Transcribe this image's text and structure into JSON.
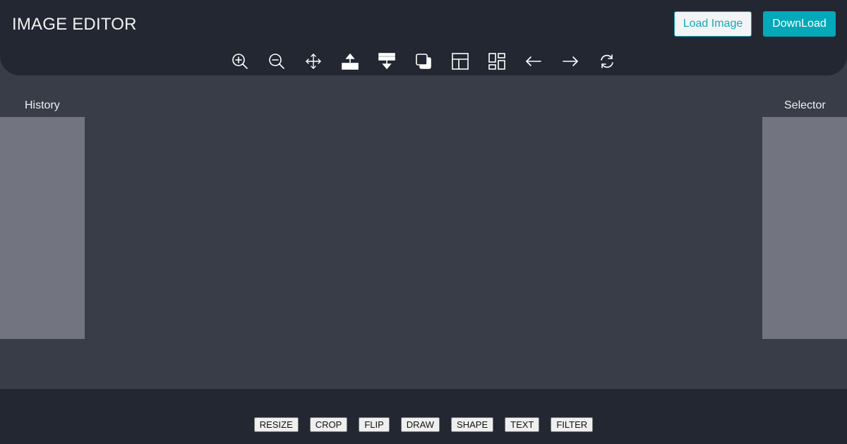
{
  "header": {
    "title": "IMAGE EDITOR",
    "load_label": "Load Image",
    "download_label": "DownLoad"
  },
  "toolbar": {
    "tools": [
      {
        "name": "zoom-in-icon"
      },
      {
        "name": "zoom-out-icon"
      },
      {
        "name": "move-icon"
      },
      {
        "name": "bring-forward-icon"
      },
      {
        "name": "send-backward-icon"
      },
      {
        "name": "layers-icon"
      },
      {
        "name": "layout-icon"
      },
      {
        "name": "grid-icon"
      },
      {
        "name": "undo-arrow-icon"
      },
      {
        "name": "redo-arrow-icon"
      },
      {
        "name": "reset-icon"
      }
    ]
  },
  "panels": {
    "history_label": "History",
    "selector_label": "Selector"
  },
  "modes": {
    "resize": "RESIZE",
    "crop": "CROP",
    "flip": "FLIP",
    "draw": "DRAW",
    "shape": "SHAPE",
    "text": "TEXT",
    "filter": "FILTER"
  },
  "colors": {
    "header_bg": "#232732",
    "canvas_bg": "#383d48",
    "panel_bg": "#72757f",
    "accent": "#04a9b9"
  }
}
